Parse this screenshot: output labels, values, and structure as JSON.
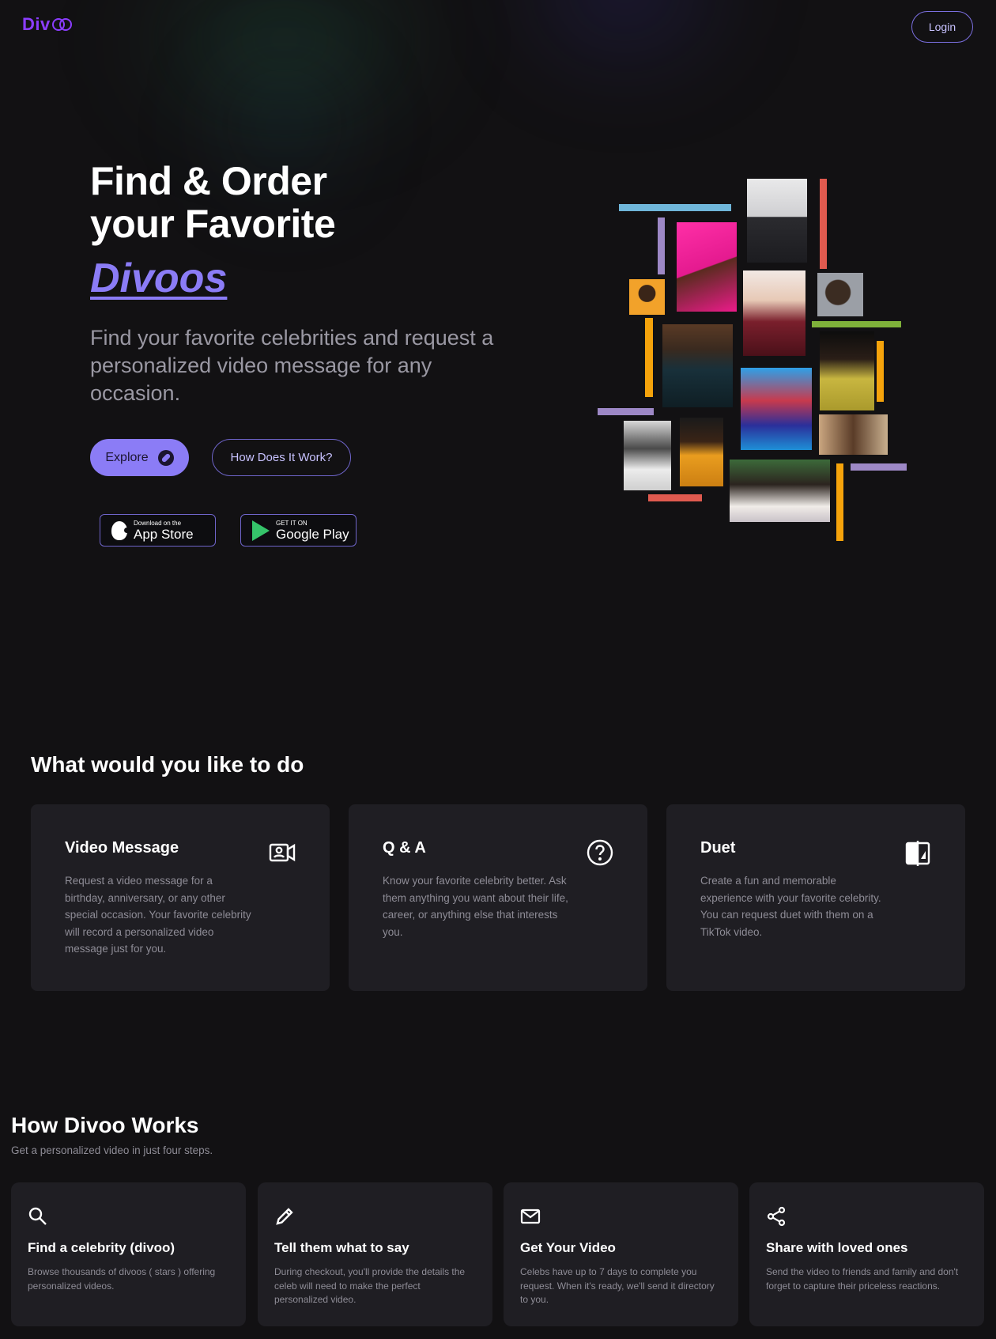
{
  "header": {
    "logo_text": "Div",
    "login_label": "Login"
  },
  "hero": {
    "title_line1": "Find & Order",
    "title_line2": "your Favorite",
    "title_accent": "Divoos",
    "subtitle": "Find your favorite celebrities and request a personalized video message for any occasion.",
    "explore_label": "Explore",
    "how_label": "How Does It Work?",
    "appstore_small": "Download on the",
    "appstore_big": "App Store",
    "googleplay_small": "GET IT ON",
    "googleplay_big": "Google Play"
  },
  "offerings": {
    "title": "What would you like to do",
    "cards": [
      {
        "title": "Video Message",
        "icon": "video-person-icon",
        "desc": "Request a video message for a birthday, anniversary, or any other special occasion. Your favorite celebrity will record a personalized video message just for you."
      },
      {
        "title": "Q & A",
        "icon": "question-circle-icon",
        "desc": "Know your favorite celebrity better. Ask them anything you want about their life, career, or anything else that interests you."
      },
      {
        "title": "Duet",
        "icon": "duet-split-icon",
        "desc": "Create a fun and memorable experience with your favorite celebrity. You can request duet with them on a TikTok video."
      }
    ]
  },
  "how_it_works": {
    "title": "How Divoo Works",
    "subtitle": "Get a personalized video in just four steps.",
    "steps": [
      {
        "icon": "search-icon",
        "title": "Find a celebrity (divoo)",
        "desc": "Browse thousands of divoos ( stars ) offering personalized videos."
      },
      {
        "icon": "pencil-icon",
        "title": "Tell them what to say",
        "desc": "During checkout, you'll provide the details the celeb will need to make the perfect personalized video."
      },
      {
        "icon": "mail-icon",
        "title": "Get Your Video",
        "desc": "Celebs have up to 7 days to complete you request. When it's ready, we'll send it directory to you."
      },
      {
        "icon": "share-icon",
        "title": "Share with loved ones",
        "desc": "Send the video to friends and family and don't forget to capture their priceless reactions."
      }
    ]
  },
  "colors": {
    "background": "#121113",
    "accent": "#8b7cf6",
    "logo": "#8b3dff",
    "card": "#1f1e23",
    "muted_text": "#8e8c96"
  }
}
